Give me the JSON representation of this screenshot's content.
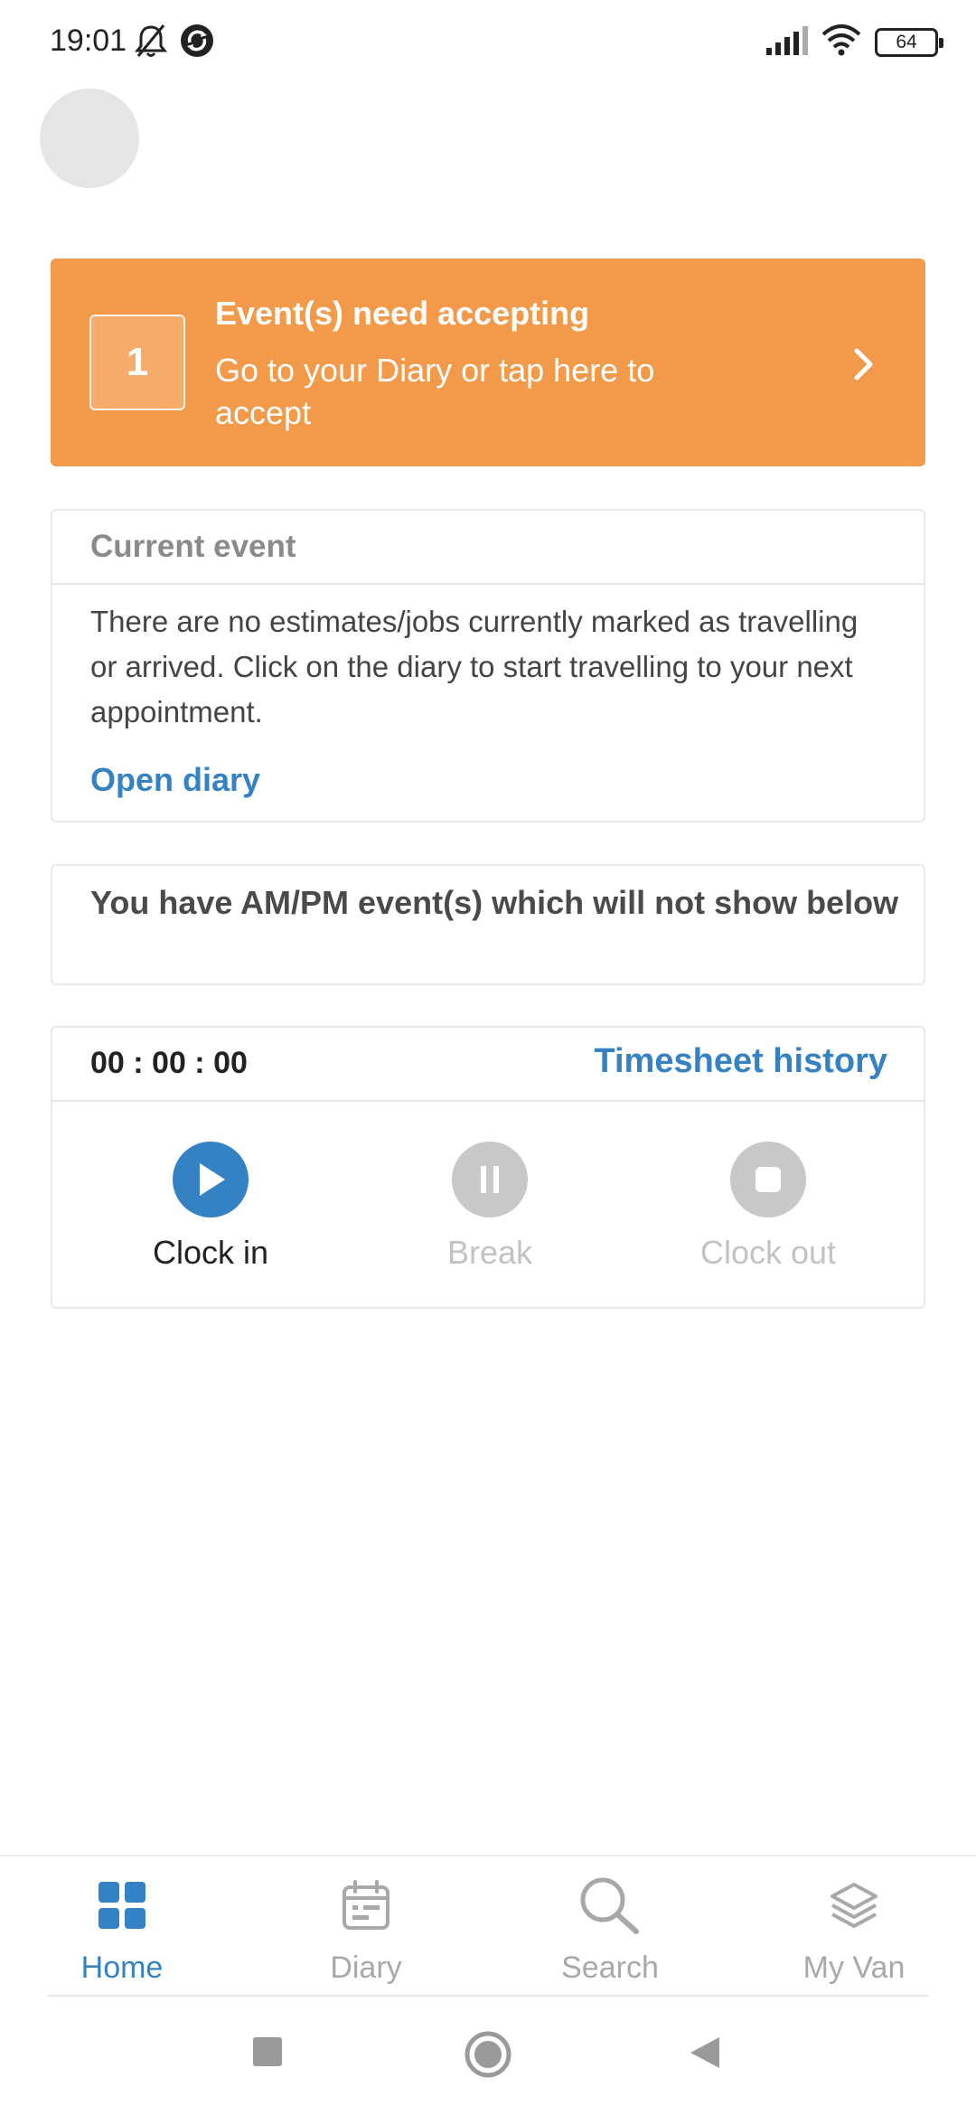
{
  "status_bar": {
    "time": "19:01",
    "battery": "64",
    "icons": [
      "bell-off-icon",
      "sync-icon",
      "signal-icon",
      "wifi-icon",
      "battery-icon"
    ]
  },
  "banner": {
    "count": "1",
    "title": "Event(s) need accepting",
    "subtitle": "Go to your Diary or tap here to accept",
    "color": "#f39a4a"
  },
  "current_event": {
    "title": "Current event",
    "body": "There are no estimates/jobs currently marked as travelling or arrived. Click on the diary to start travelling to your next appointment.",
    "link": "Open diary"
  },
  "ampm_notice": {
    "text": "You have AM/PM event(s) which will not show below"
  },
  "timesheet": {
    "timer": "00 : 00 : 00",
    "history_link": "Timesheet history",
    "buttons": {
      "clock_in": "Clock in",
      "break": "Break",
      "clock_out": "Clock out"
    }
  },
  "bottom_nav": {
    "items": [
      {
        "label": "Home",
        "icon": "grid-icon",
        "active": true
      },
      {
        "label": "Diary",
        "icon": "calendar-icon",
        "active": false
      },
      {
        "label": "Search",
        "icon": "search-icon",
        "active": false
      },
      {
        "label": "My Van",
        "icon": "layers-icon",
        "active": false
      }
    ]
  },
  "colors": {
    "accent": "#3482c3",
    "orange": "#f39a4a",
    "inactive": "#a8a8a8"
  }
}
